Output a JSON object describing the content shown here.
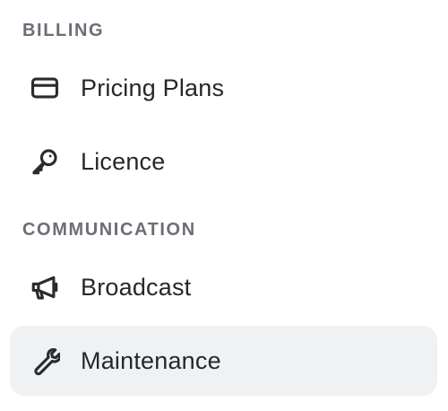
{
  "sections": [
    {
      "header": "BILLING",
      "items": [
        {
          "label": "Pricing Plans",
          "icon": "credit-card-icon",
          "active": false
        },
        {
          "label": "Licence",
          "icon": "key-icon",
          "active": false
        }
      ]
    },
    {
      "header": "COMMUNICATION",
      "items": [
        {
          "label": "Broadcast",
          "icon": "megaphone-icon",
          "active": false
        },
        {
          "label": "Maintenance",
          "icon": "wrench-icon",
          "active": true
        }
      ]
    }
  ],
  "colors": {
    "header_text": "#6b6e76",
    "item_text": "#26272b",
    "active_background": "#f0f1f3"
  }
}
